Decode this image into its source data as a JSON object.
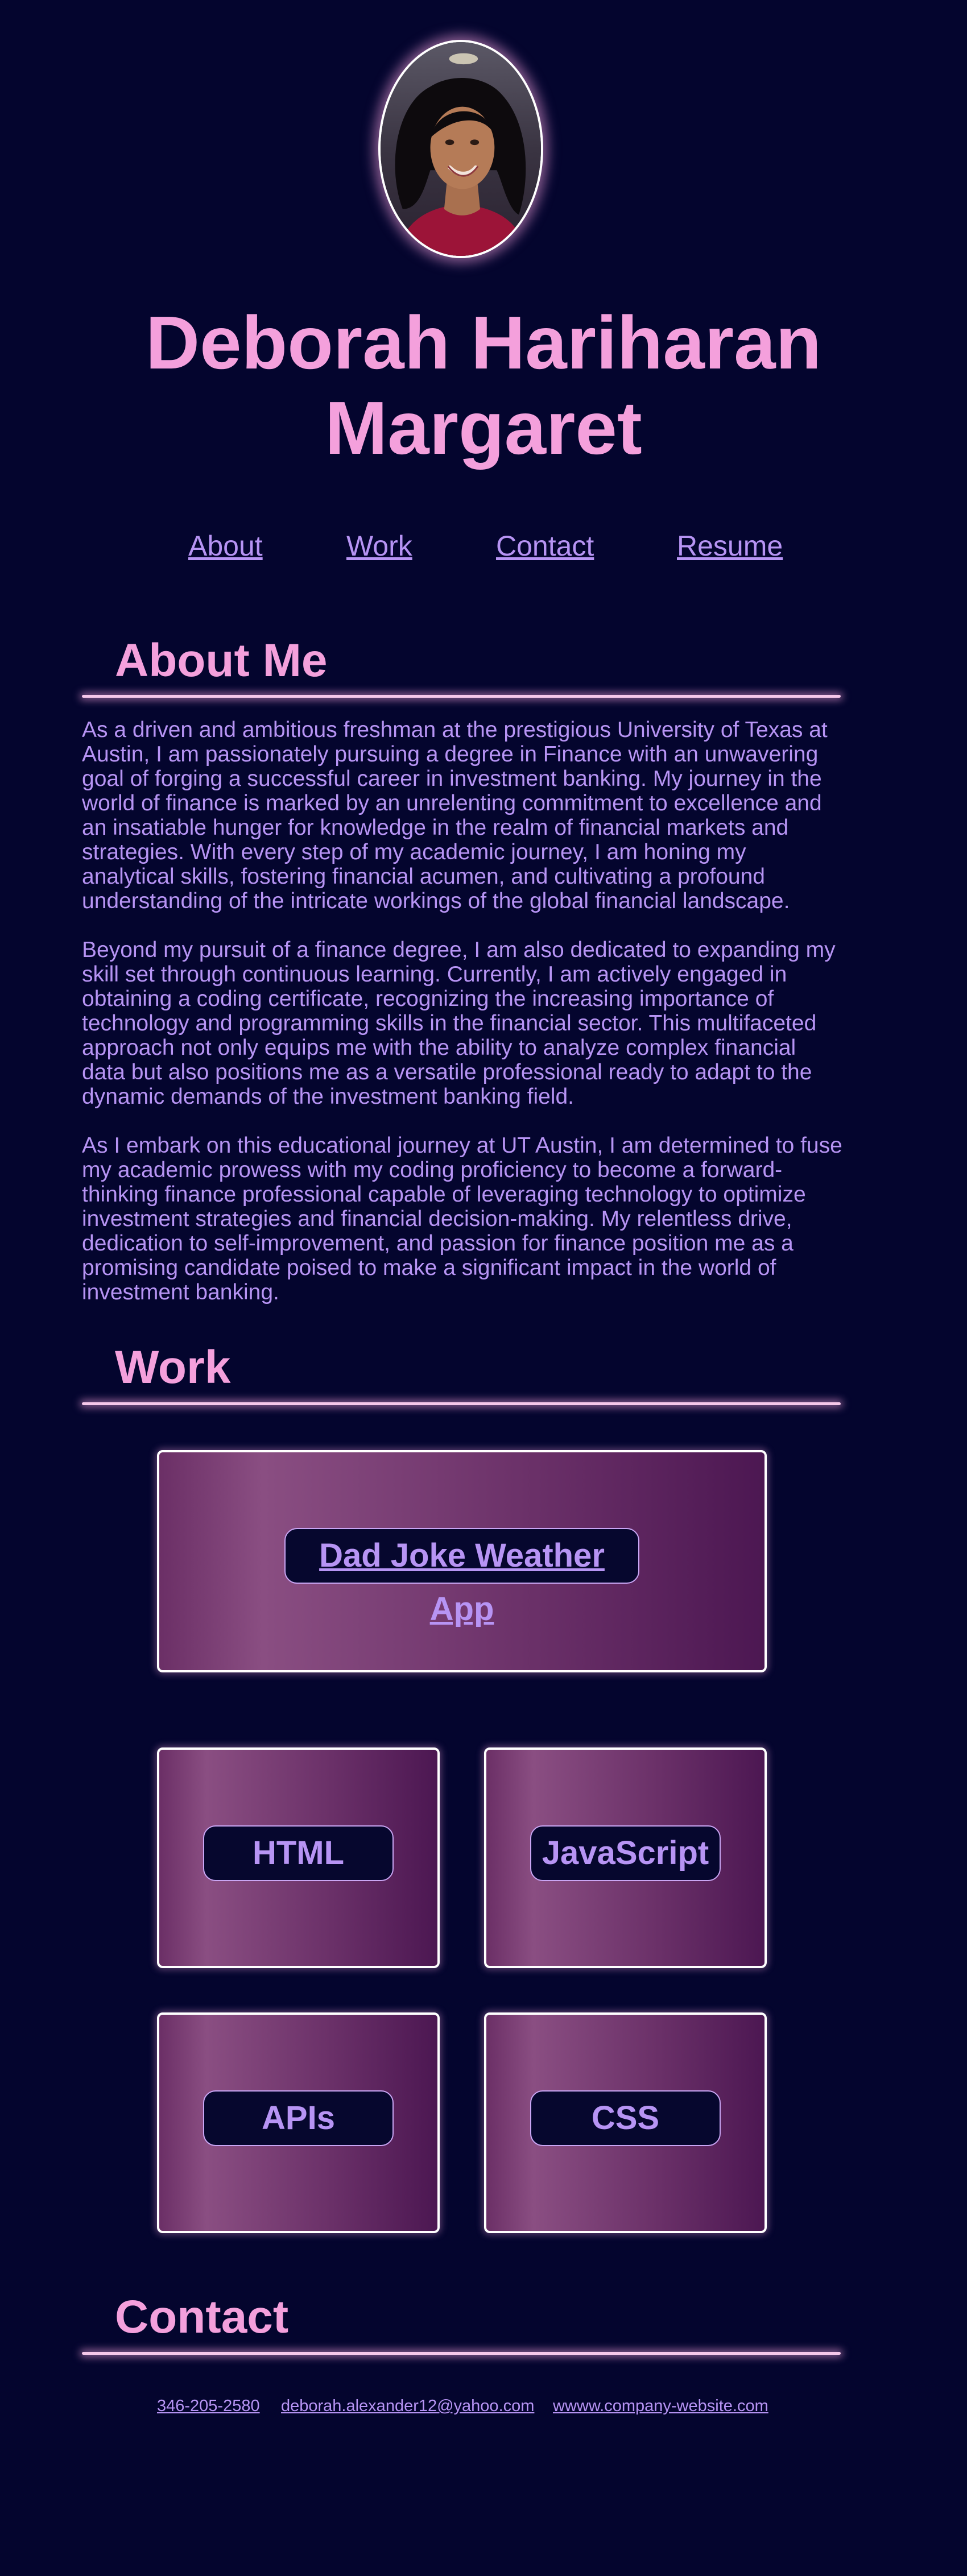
{
  "profile": {
    "name": "Deborah Hariharan Margaret"
  },
  "nav": {
    "items": [
      {
        "label": "About"
      },
      {
        "label": "Work"
      },
      {
        "label": "Contact"
      },
      {
        "label": "Resume"
      }
    ]
  },
  "about": {
    "title": "About Me",
    "paragraphs": [
      "As a driven and ambitious freshman at the prestigious University of Texas at Austin, I am passionately pursuing a degree in Finance with an unwavering goal of forging a successful career in investment banking. My journey in the world of finance is marked by an unrelenting commitment to excellence and an insatiable hunger for knowledge in the realm of financial markets and strategies. With every step of my academic journey, I am honing my analytical skills, fostering financial acumen, and cultivating a profound understanding of the intricate workings of the global financial landscape.",
      "Beyond my pursuit of a finance degree, I am also dedicated to expanding my skill set through continuous learning. Currently, I am actively engaged in obtaining a coding certificate, recognizing the increasing importance of technology and programming skills in the financial sector. This multifaceted approach not only equips me with the ability to analyze complex financial data but also positions me as a versatile professional ready to adapt to the dynamic demands of the investment banking field.",
      "As I embark on this educational journey at UT Austin, I am determined to fuse my academic prowess with my coding proficiency to become a forward-thinking finance professional capable of leveraging technology to optimize investment strategies and financial decision-making. My relentless drive, dedication to self-improvement, and passion for finance position me as a promising candidate poised to make a significant impact in the world of investment banking."
    ]
  },
  "work": {
    "title": "Work",
    "featured": {
      "label": "Dad Joke Weather App"
    },
    "skills": [
      {
        "label": "HTML"
      },
      {
        "label": "JavaScript"
      },
      {
        "label": "APIs"
      },
      {
        "label": "CSS"
      }
    ]
  },
  "contact": {
    "title": "Contact",
    "phone": "346-205-2580",
    "email": "deborah.alexander12@yahoo.com",
    "website": "wwww.company-website.com"
  },
  "colors": {
    "background": "#04052e",
    "heading_pink": "#f4a0dc",
    "text_lavender": "#b794f4",
    "card_purple": "#6b2f66"
  }
}
